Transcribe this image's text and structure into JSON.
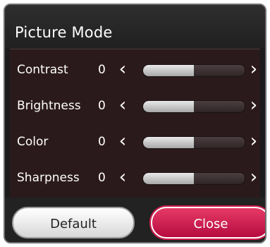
{
  "dialog": {
    "title": "Picture Mode",
    "settings": [
      {
        "label": "Contrast",
        "value": "0",
        "level": 0.5
      },
      {
        "label": "Brightness",
        "value": "0",
        "level": 0.5
      },
      {
        "label": "Color",
        "value": "0",
        "level": 0.5
      },
      {
        "label": "Sharpness",
        "value": "0",
        "level": 0.5
      }
    ],
    "arrows": {
      "left": "‹",
      "right": "›"
    },
    "buttons": {
      "default": "Default",
      "close": "Close"
    }
  },
  "colors": {
    "accent": "#d11c4e",
    "panel": "#2b1a1c",
    "title_bg": "#2a2a2a"
  }
}
